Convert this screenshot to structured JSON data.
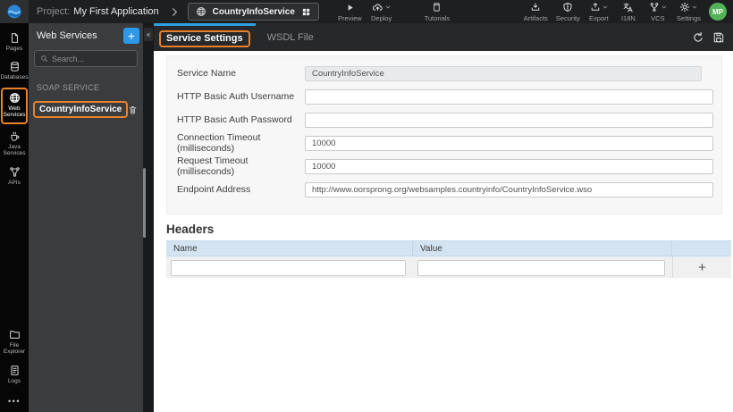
{
  "topbar": {
    "project_label": "Project:",
    "project_name": "My First Application",
    "service_name": "CountryInfoService",
    "preview": "Preview",
    "deploy": "Deploy",
    "tutorials": "Tutorials",
    "artifacts": "Artifacts",
    "security": "Security",
    "export": "Export",
    "i18n": "I18N",
    "vcs": "VCS",
    "settings": "Settings",
    "avatar_initials": "MP"
  },
  "rail": {
    "pages": "Pages",
    "databases": "Databases",
    "web_services": "Web Services",
    "java_services": "Java Services",
    "apis": "APIs",
    "file_explorer": "File Explorer",
    "logs": "Logs",
    "more_glyph": "•••"
  },
  "sidebar": {
    "title": "Web Services",
    "add_label": "+",
    "collapse_glyph": "«",
    "search_placeholder": "Search...",
    "section_label": "SOAP SERVICE",
    "service_item": "CountryInfoService"
  },
  "tabs": {
    "service_settings": "Service Settings",
    "wsdl_file": "WSDL File"
  },
  "form": {
    "fields": [
      {
        "label": "Service Name",
        "value": "CountryInfoService"
      },
      {
        "label": "HTTP Basic Auth Username",
        "value": ""
      },
      {
        "label": "HTTP Basic Auth Password",
        "value": ""
      },
      {
        "label": "Connection Timeout (milliseconds)",
        "value": "10000"
      },
      {
        "label": "Request Timeout (milliseconds)",
        "value": "10000"
      },
      {
        "label": "Endpoint Address",
        "value": "http://www.oorsprong.org/websamples.countryinfo/CountryInfoService.wso"
      }
    ]
  },
  "headers_table": {
    "title": "Headers",
    "columns": [
      "Name",
      "Value"
    ],
    "add_button": "+"
  },
  "colors": {
    "accent_blue": "#2f9fe0",
    "annotation_orange": "#e8822d",
    "avatar_green": "#53b257",
    "table_header_blue": "#d3e3f1",
    "topbar_bg": "#1d1f21",
    "sidebar_bg": "#3a3c3e"
  }
}
